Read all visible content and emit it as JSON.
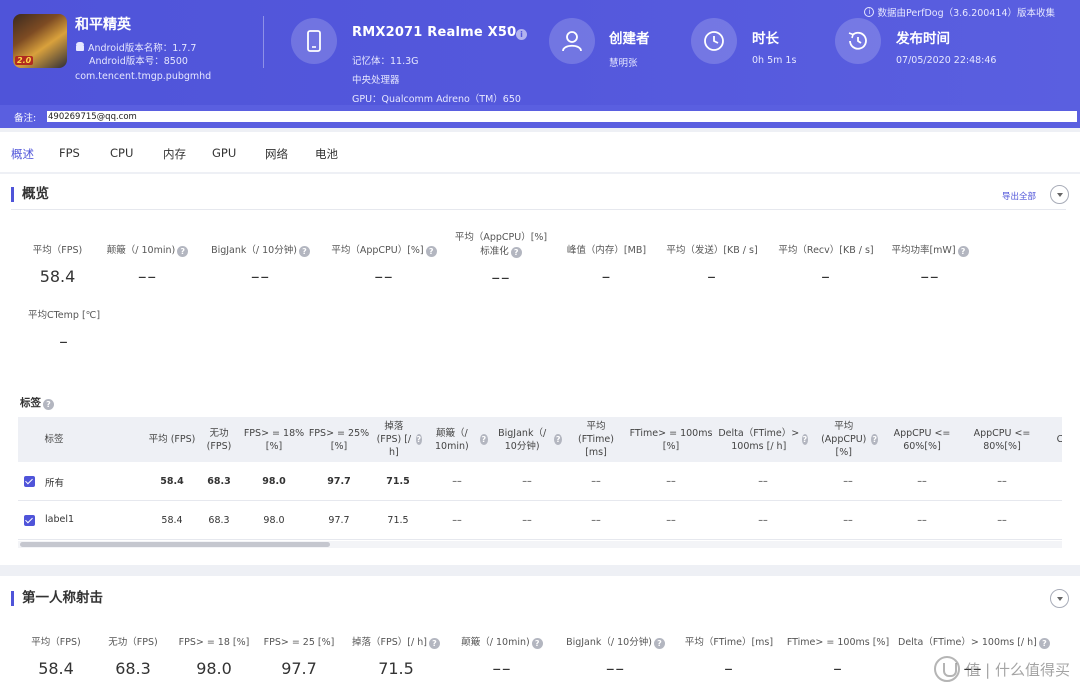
{
  "header": {
    "app_name": "和平精英",
    "app_icon_text": "和平精英2.0",
    "android_version_name": "Android版本名称：1.7.7",
    "android_version_code": "Android版本号：8500",
    "package": "com.tencent.tmgp.pubgmhd",
    "device_name": "RMX2071 Realme X50",
    "device_more": "···",
    "device_memory": "记忆体：11.3G",
    "device_cpu": "中央处理器",
    "device_gpu": "GPU：Qualcomm Adreno（TM）650",
    "creator_label": "创建者",
    "creator_value": "慧明张",
    "duration_label": "时长",
    "duration_value": "0h 5m 1s",
    "publish_label": "发布时间",
    "publish_value": "07/05/2020 22:48:46",
    "perfdog_note": "数据由PerfDog（3.6.200414）版本收集",
    "icons": [
      "phone-icon",
      "user-icon",
      "clock-icon",
      "history-icon",
      "info-icon"
    ]
  },
  "remark": {
    "label": "备注:",
    "value": "490269715@qq.com"
  },
  "tabs": [
    "概述",
    "FPS",
    "CPU",
    "内存",
    "GPU",
    "网络",
    "电池"
  ],
  "active_tab": "概述",
  "overview": {
    "title": "概览",
    "export_label": "导出全部",
    "metrics": [
      {
        "label": "平均（FPS)",
        "value": "58.4",
        "help": false
      },
      {
        "label": "颠簸（/ 10min)",
        "value": "––",
        "help": true
      },
      {
        "label": "BigJank（/ 10分钟)",
        "value": "––",
        "help": true
      },
      {
        "label": "平均（AppCPU）[%]",
        "value": "––",
        "help": true
      },
      {
        "label": "平均（AppCPU）[%]",
        "label2": "标准化",
        "value": "––",
        "help": true
      },
      {
        "label": "峰值（内存）[MB]",
        "value": "–",
        "help": false
      },
      {
        "label": "平均（发送）[KB / s]",
        "value": "–",
        "help": false
      },
      {
        "label": "平均（Recv）[KB / s]",
        "value": "–",
        "help": false
      },
      {
        "label": "平均功率[mW]",
        "value": "––",
        "help": true
      },
      {
        "label": "平均CTemp [℃]",
        "value": "–",
        "help": false
      }
    ]
  },
  "tags": {
    "heading": "标签",
    "columns": [
      "标签",
      "平均 (FPS)",
      "无功 (FPS)",
      "FPS> = 18% [%]",
      "FPS> = 25% [%]",
      "掉落 (FPS) [/ h]",
      "颠簸（/ 10min)",
      "BigJank（/ 10分钟)",
      "平均 (FTime) [ms]",
      "FTime> = 100ms [%]",
      "Delta（FTime）> 100ms [/ h]",
      "平均 (AppCPU) [%]",
      "AppCPU <= 60%[%]",
      "AppCPU <= 80%[%]",
      "C"
    ],
    "rows": [
      {
        "name": "所有",
        "values": [
          "58.4",
          "68.3",
          "98.0",
          "97.7",
          "71.5",
          "––",
          "––",
          "––",
          "––",
          "––",
          "––",
          "––",
          "––"
        ]
      },
      {
        "name": "label1",
        "values": [
          "58.4",
          "68.3",
          "98.0",
          "97.7",
          "71.5",
          "––",
          "––",
          "––",
          "––",
          "––",
          "––",
          "––",
          "––"
        ]
      }
    ]
  },
  "fps_section": {
    "title": "第一人称射击",
    "metrics": [
      {
        "label": "平均（FPS)",
        "value": "58.4",
        "help": false
      },
      {
        "label": "无功（FPS)",
        "value": "68.3",
        "help": false
      },
      {
        "label": "FPS> = 18 [%]",
        "value": "98.0",
        "help": false
      },
      {
        "label": "FPS> = 25 [%]",
        "value": "97.7",
        "help": false
      },
      {
        "label": "掉落（FPS）[/ h]",
        "value": "71.5",
        "help": true
      },
      {
        "label": "颠簸（/ 10min)",
        "value": "––",
        "help": true
      },
      {
        "label": "BigJank（/ 10分钟)",
        "value": "––",
        "help": true
      },
      {
        "label": "平均（FTime）[ms]",
        "value": "–",
        "help": false
      },
      {
        "label": "FTime> = 100ms [%]",
        "value": "–",
        "help": false
      },
      {
        "label": "Delta（FTime）> 100ms [/ h]",
        "value": "––",
        "help": true
      }
    ]
  },
  "watermark": "值 | 什么值得买"
}
